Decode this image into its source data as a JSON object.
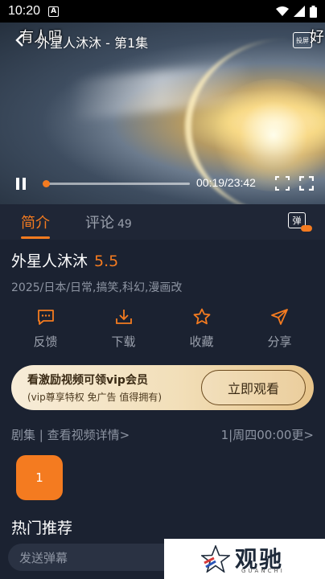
{
  "status_bar": {
    "time": "10:20",
    "notif_letter": "A"
  },
  "player": {
    "title": "外星人沐沐 - 第1集",
    "danmaku": [
      "有人吗",
      "好"
    ],
    "cast_label": "投屏",
    "current_time": "00:19",
    "total_time": "23:42",
    "time_display": "00:19/23:42",
    "progress_fraction": 0.014
  },
  "tabs": [
    {
      "label": "简介",
      "active": true
    },
    {
      "label": "评论",
      "count": "49",
      "active": false
    }
  ],
  "danmaku_toggle": {
    "label": "弹",
    "on": true
  },
  "show": {
    "title": "外星人沐沐",
    "score": "5.5",
    "meta": "2025/日本/日常,搞笑,科幻,漫画改"
  },
  "actions": [
    {
      "label": "反馈",
      "icon": "feedback-icon"
    },
    {
      "label": "下载",
      "icon": "download-icon"
    },
    {
      "label": "收藏",
      "icon": "star-icon"
    },
    {
      "label": "分享",
      "icon": "share-icon"
    }
  ],
  "vip_banner": {
    "headline": "看激励视频可领vip会员",
    "subline": "(vip尊享特权 免广告 值得拥有)",
    "button": "立即观看"
  },
  "episodes": {
    "left_label": "剧集 | 查看视频详情>",
    "right_label": "1|周四00:00更>",
    "items": [
      "1"
    ]
  },
  "hot": {
    "title": "热门推荐"
  },
  "comment_input": {
    "placeholder": "发送弹幕"
  },
  "watermark": {
    "brand": "观驰",
    "sub": "GUANCHI"
  },
  "colors": {
    "accent": "#f47b20",
    "background": "#1b2231"
  }
}
